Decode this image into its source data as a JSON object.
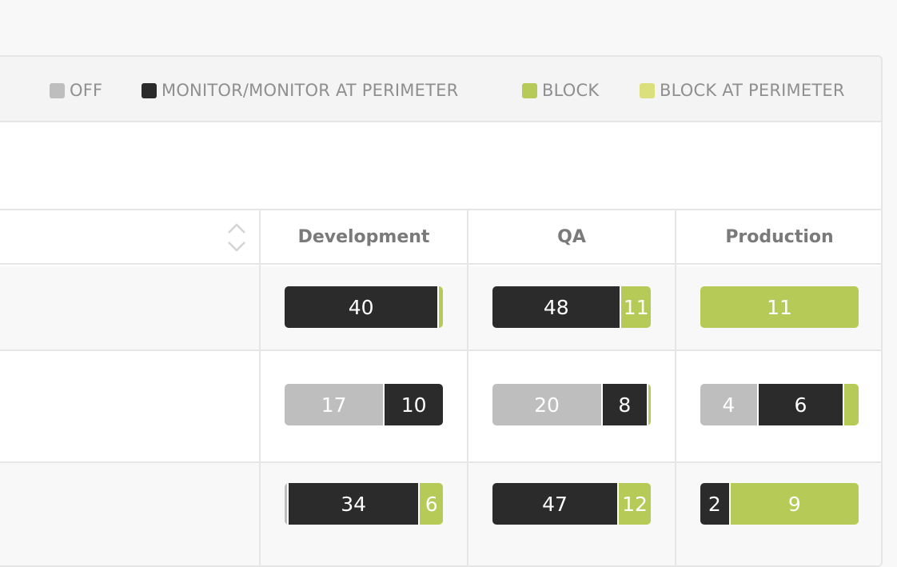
{
  "colors": {
    "off": "#bebebe",
    "monitor": "#2b2b2b",
    "block": "#b5ca57",
    "block_perimeter": "#dce07c"
  },
  "legend": {
    "off": "OFF",
    "monitor": "MONITOR/MONITOR AT PERIMETER",
    "block": "BLOCK",
    "block_perimeter": "BLOCK AT PERIMETER"
  },
  "table": {
    "columns": [
      "Development",
      "QA",
      "Production"
    ],
    "rows": [
      {
        "cells": [
          {
            "off": 0,
            "monitor": 40,
            "block": 1,
            "off_label": "",
            "monitor_label": "40",
            "block_label": ""
          },
          {
            "off": 0,
            "monitor": 48,
            "block": 11,
            "off_label": "",
            "monitor_label": "48",
            "block_label": "11"
          },
          {
            "off": 0,
            "monitor": 0,
            "block": 11,
            "off_label": "",
            "monitor_label": "",
            "block_label": "11"
          }
        ]
      },
      {
        "cells": [
          {
            "off": 17,
            "monitor": 10,
            "block": 0,
            "off_label": "17",
            "monitor_label": "10",
            "block_label": ""
          },
          {
            "off": 20,
            "monitor": 8,
            "block": 0.5,
            "off_label": "20",
            "monitor_label": "8",
            "block_label": ""
          },
          {
            "off": 4,
            "monitor": 6,
            "block": 1,
            "off_label": "4",
            "monitor_label": "6",
            "block_label": ""
          }
        ]
      },
      {
        "cells": [
          {
            "off": 0.3,
            "monitor": 34,
            "block": 6,
            "off_label": "",
            "monitor_label": "34",
            "block_label": "6"
          },
          {
            "off": 0,
            "monitor": 47,
            "block": 12,
            "off_label": "",
            "monitor_label": "47",
            "block_label": "12"
          },
          {
            "off": 0,
            "monitor": 2,
            "block": 9,
            "off_label": "",
            "monitor_label": "2",
            "block_label": "9"
          }
        ]
      }
    ]
  }
}
